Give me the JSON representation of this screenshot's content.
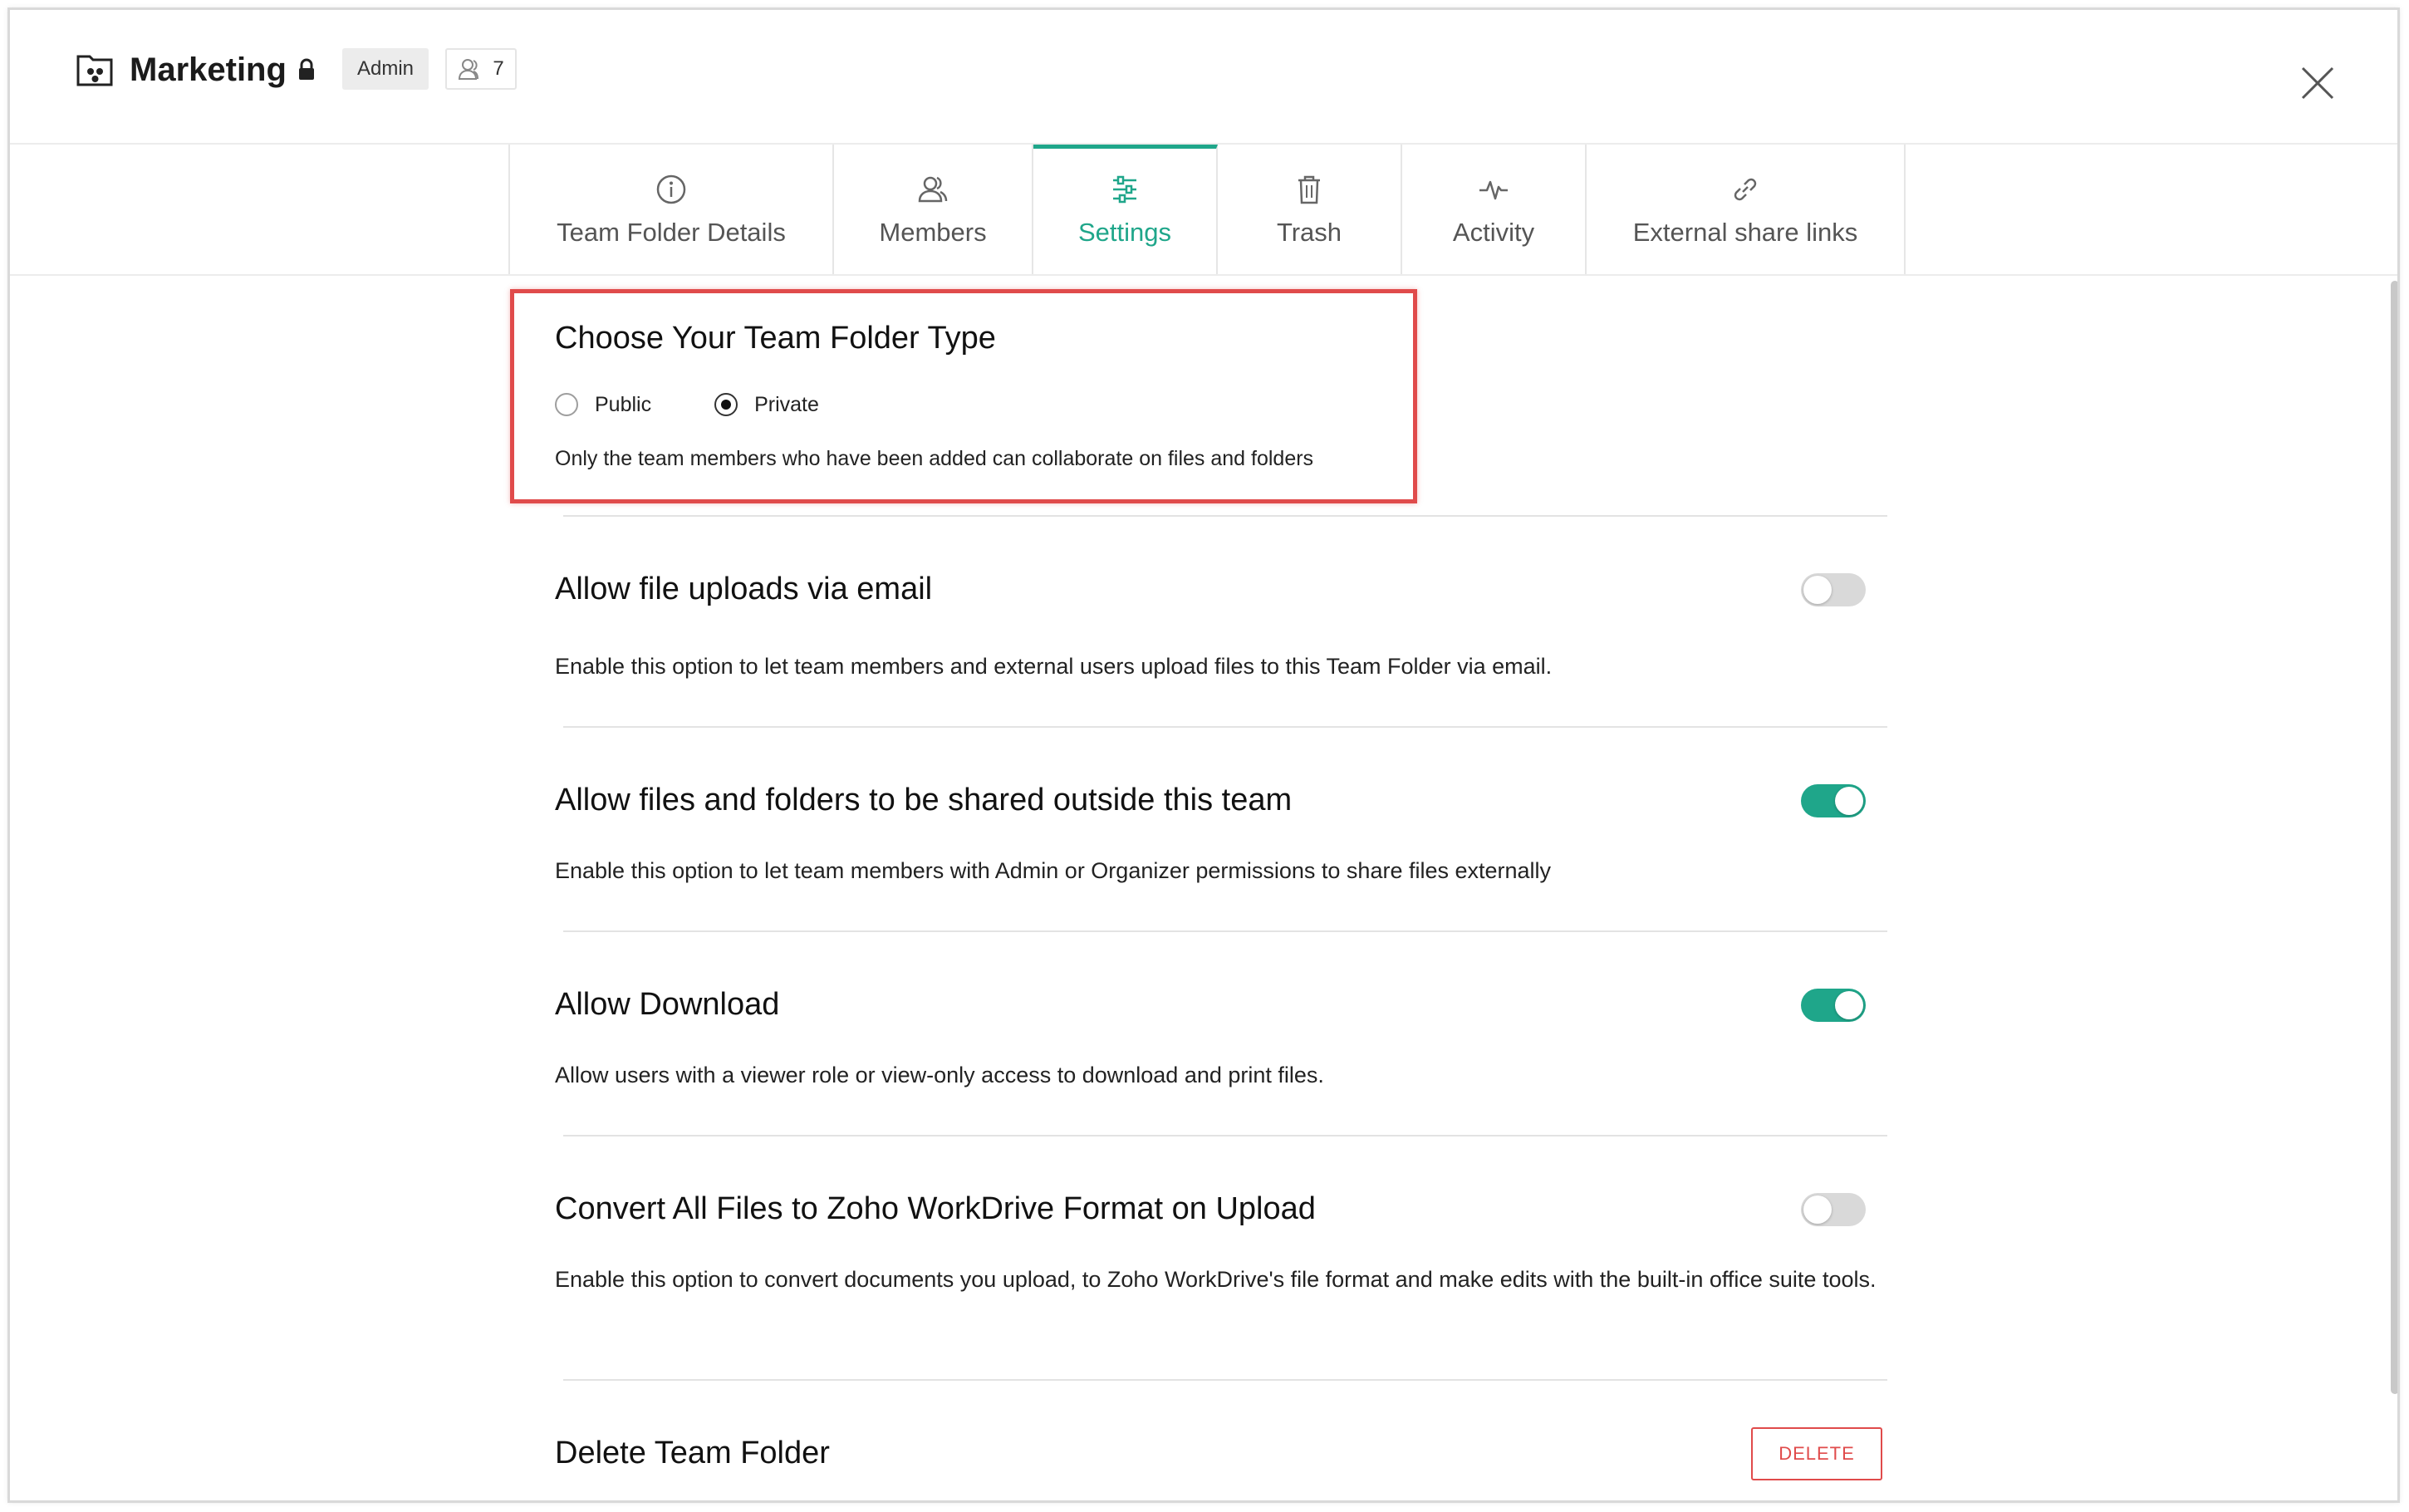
{
  "header": {
    "title": "Marketing",
    "role": "Admin",
    "member_count": "7"
  },
  "tabs": [
    {
      "label": "Team Folder Details",
      "icon": "info-icon"
    },
    {
      "label": "Members",
      "icon": "members-icon"
    },
    {
      "label": "Settings",
      "icon": "sliders-icon",
      "active": true
    },
    {
      "label": "Trash",
      "icon": "trash-icon"
    },
    {
      "label": "Activity",
      "icon": "activity-icon"
    },
    {
      "label": "External share links",
      "icon": "link-icon"
    }
  ],
  "folder_type": {
    "title": "Choose Your Team Folder Type",
    "options": [
      {
        "label": "Public",
        "selected": false
      },
      {
        "label": "Private",
        "selected": true
      }
    ],
    "description": "Only the team members who have been added can collaborate on files and folders"
  },
  "settings": [
    {
      "title": "Allow file uploads via email",
      "description": "Enable this option to let team members and external users upload files to this Team Folder via email.",
      "enabled": false
    },
    {
      "title": "Allow files and folders to be shared outside this team",
      "description": "Enable this option to let team members with Admin or Organizer permissions to share files externally",
      "enabled": true
    },
    {
      "title": "Allow Download",
      "description": "Allow users with a viewer role or view-only access to download and print files.",
      "enabled": true
    },
    {
      "title": "Convert All Files to Zoho WorkDrive Format on Upload",
      "description": "Enable this option to convert documents you upload, to Zoho WorkDrive's file format and make edits with the built-in office suite tools.",
      "enabled": false
    }
  ],
  "delete_section": {
    "title": "Delete Team Folder",
    "button_label": "DELETE"
  },
  "colors": {
    "accent": "#1fa68a",
    "danger": "#e04b4b"
  }
}
